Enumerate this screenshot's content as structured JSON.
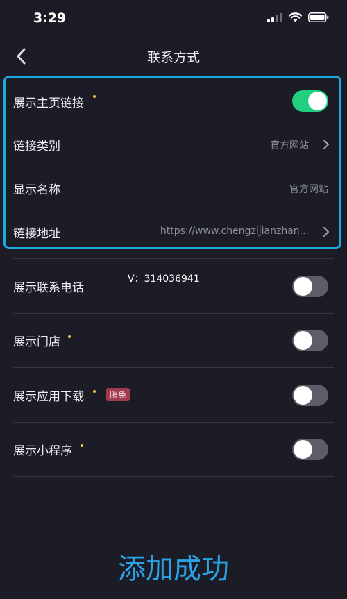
{
  "status_bar": {
    "time": "3:29"
  },
  "nav": {
    "title": "联系方式"
  },
  "highlighted_section": {
    "show_homepage_link": {
      "label": "展示主页链接",
      "toggle_on": true
    },
    "link_type": {
      "label": "链接类别",
      "value": "官方网站"
    },
    "display_name": {
      "label": "显示名称",
      "value": "官方网站"
    },
    "link_url": {
      "label": "链接地址",
      "value": "https://www.chengzijianzhan..."
    }
  },
  "settings": {
    "show_phone": {
      "label": "展示联系电话",
      "toggle_on": false
    },
    "show_store": {
      "label": "展示门店",
      "toggle_on": false
    },
    "show_app_download": {
      "label": "展示应用下载",
      "badge": "限免",
      "toggle_on": false
    },
    "show_mini_program": {
      "label": "展示小程序",
      "toggle_on": false
    }
  },
  "overlay_text": "V：314036941",
  "success_message": "添加成功",
  "colors": {
    "accent_blue": "#1fa8e0",
    "toggle_on": "#21cf7f",
    "dot_yellow": "#f7c844",
    "badge": "#a23b52"
  },
  "icons": [
    "back-chevron-icon",
    "chevron-right-icon",
    "cellular-signal-icon",
    "wifi-icon",
    "battery-icon"
  ]
}
